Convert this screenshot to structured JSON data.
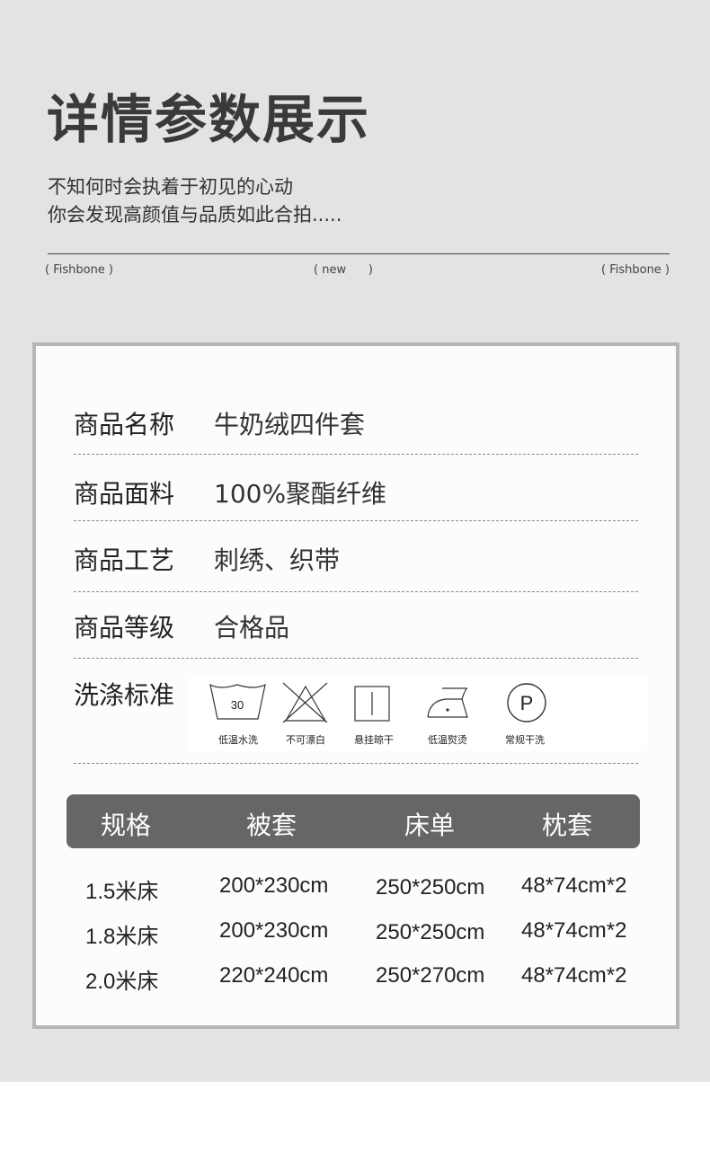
{
  "header": {
    "title": "详情参数展示",
    "subtitle_line1": "不知何时会执着于初见的心动",
    "subtitle_line2": "你会发现高颜值与品质如此合拍.....",
    "tag_left": "( Fishbone )",
    "tag_mid": "( new      )",
    "tag_right": "( Fishbone )"
  },
  "details": [
    {
      "label": "商品名称",
      "value": "牛奶绒四件套"
    },
    {
      "label": "商品面料",
      "value": "100%聚酯纤维"
    },
    {
      "label": "商品工艺",
      "value": "刺绣、织带"
    },
    {
      "label": "商品等级",
      "value": "合格品"
    }
  ],
  "care": {
    "label": "洗涤标准",
    "wash_temp": "30",
    "items": [
      {
        "icon": "wash-30-icon",
        "label": "低温水洗"
      },
      {
        "icon": "no-bleach-icon",
        "label": "不可漂白"
      },
      {
        "icon": "hang-dry-icon",
        "label": "悬挂晾干"
      },
      {
        "icon": "low-iron-icon",
        "label": "低温熨烫"
      },
      {
        "icon": "dry-clean-p-icon",
        "label": "常规干洗"
      }
    ],
    "dry_clean_letter": "P"
  },
  "specs": {
    "headers": [
      "规格",
      "被套",
      "床单",
      "枕套"
    ],
    "rows": [
      [
        "1.5米床",
        "200*230cm",
        "250*250cm",
        "48*74cm*2"
      ],
      [
        "1.8米床",
        "200*230cm",
        "250*250cm",
        "48*74cm*2"
      ],
      [
        "2.0米床",
        "220*240cm",
        "250*270cm",
        "48*74cm*2"
      ]
    ]
  }
}
